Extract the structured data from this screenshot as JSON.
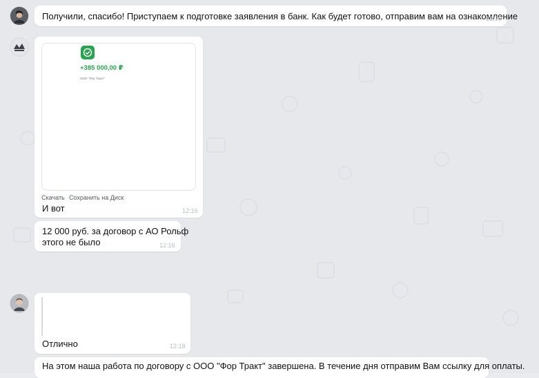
{
  "messages": [
    {
      "text": "Получили, спасибо! Приступаем к подготовке заявления в банк. Как будет готово, отправим вам на ознакомление",
      "time": "12:16"
    },
    {
      "preview": {
        "amount": "+385 000,00 ₽",
        "payee": "ООО \"Фор Тракт\""
      },
      "actions": {
        "download": "Скачать",
        "save_to_disk": "Сохранить на Диск"
      },
      "text": "И вот",
      "time": "12:16"
    },
    {
      "lines": [
        "12 000 руб. за договор с АО Рольф",
        "этого не было"
      ],
      "time": "12:16"
    },
    {
      "text": "Отлично",
      "time": "12:18"
    },
    {
      "text": "На этом наша работа по договору с ООО \"Фор Тракт\" завершена. В течение дня отправим Вам ссылку для оплаты."
    }
  ],
  "colors": {
    "accent_green": "#2aa34f",
    "bubble": "#ffffff",
    "background": "#e6e8ec"
  },
  "icons": {
    "payment_status": "check-icon"
  }
}
